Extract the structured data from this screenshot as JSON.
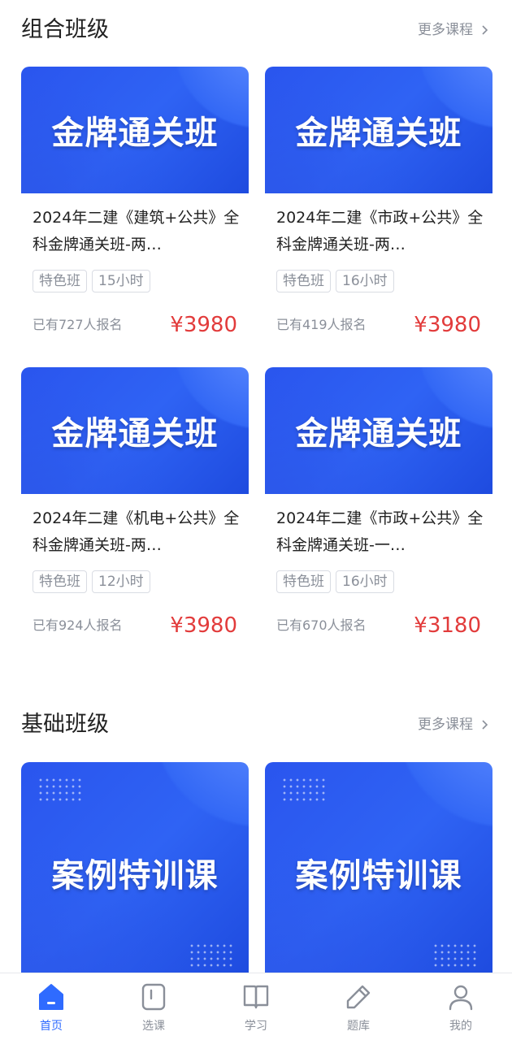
{
  "sections": [
    {
      "title": "组合班级",
      "more": "更多课程",
      "cards": [
        {
          "banner": "金牌通关班",
          "title": "2024年二建《建筑+公共》全科金牌通关班-两…",
          "tags": [
            "特色班",
            "15小时"
          ],
          "enroll": "已有727人报名",
          "price": "¥3980"
        },
        {
          "banner": "金牌通关班",
          "title": "2024年二建《市政+公共》全科金牌通关班-两…",
          "tags": [
            "特色班",
            "16小时"
          ],
          "enroll": "已有419人报名",
          "price": "¥3980"
        },
        {
          "banner": "金牌通关班",
          "title": "2024年二建《机电+公共》全科金牌通关班-两…",
          "tags": [
            "特色班",
            "12小时"
          ],
          "enroll": "已有924人报名",
          "price": "¥3980"
        },
        {
          "banner": "金牌通关班",
          "title": "2024年二建《市政+公共》全科金牌通关班-一…",
          "tags": [
            "特色班",
            "16小时"
          ],
          "enroll": "已有670人报名",
          "price": "¥3180"
        }
      ]
    },
    {
      "title": "基础班级",
      "more": "更多课程",
      "cards": [
        {
          "banner": "案例特训课"
        },
        {
          "banner": "案例特训课"
        }
      ]
    }
  ],
  "tabbar": {
    "active": 0,
    "items": [
      {
        "label": "首页",
        "icon": "home-icon"
      },
      {
        "label": "选课",
        "icon": "course-select-icon"
      },
      {
        "label": "学习",
        "icon": "book-icon"
      },
      {
        "label": "题库",
        "icon": "pencil-icon"
      },
      {
        "label": "我的",
        "icon": "user-icon"
      }
    ]
  },
  "colors": {
    "accent": "#2f6bff",
    "price": "#e23b3b",
    "banner": "#2f63f4"
  }
}
